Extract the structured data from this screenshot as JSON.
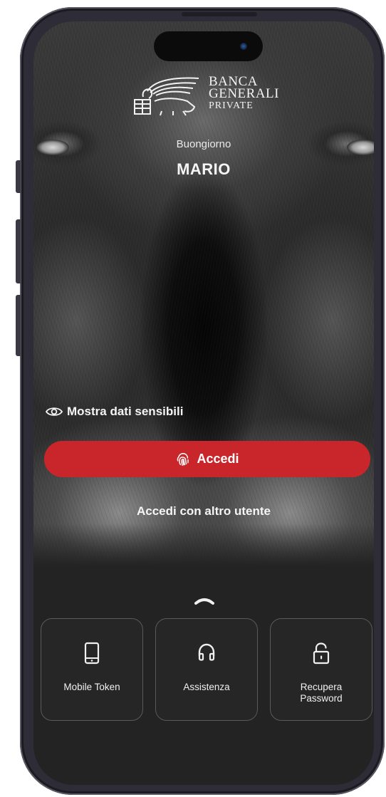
{
  "brand": {
    "line1": "BANCA",
    "line2": "GENERALI",
    "line3": "PRIVATE"
  },
  "greeting": {
    "salutation": "Buongiorno",
    "name": "MARIO"
  },
  "privacy": {
    "label": "Mostra dati sensibili",
    "icon": "eye-icon"
  },
  "login": {
    "button_label": "Accedi",
    "button_icon": "fingerprint-icon",
    "alt_user_label": "Accedi con altro utente"
  },
  "drawer": {
    "handle_icon": "chevron-up-icon",
    "tiles": [
      {
        "label": "Mobile Token",
        "icon": "smartphone-icon"
      },
      {
        "label": "Assistenza",
        "icon": "headphones-icon"
      },
      {
        "label": "Recupera\nPassword",
        "icon": "unlock-icon"
      }
    ]
  },
  "colors": {
    "accent": "#c8262b",
    "background": "#232323",
    "tile_border": "#5a5a5a",
    "text": "#f5f5f5"
  }
}
